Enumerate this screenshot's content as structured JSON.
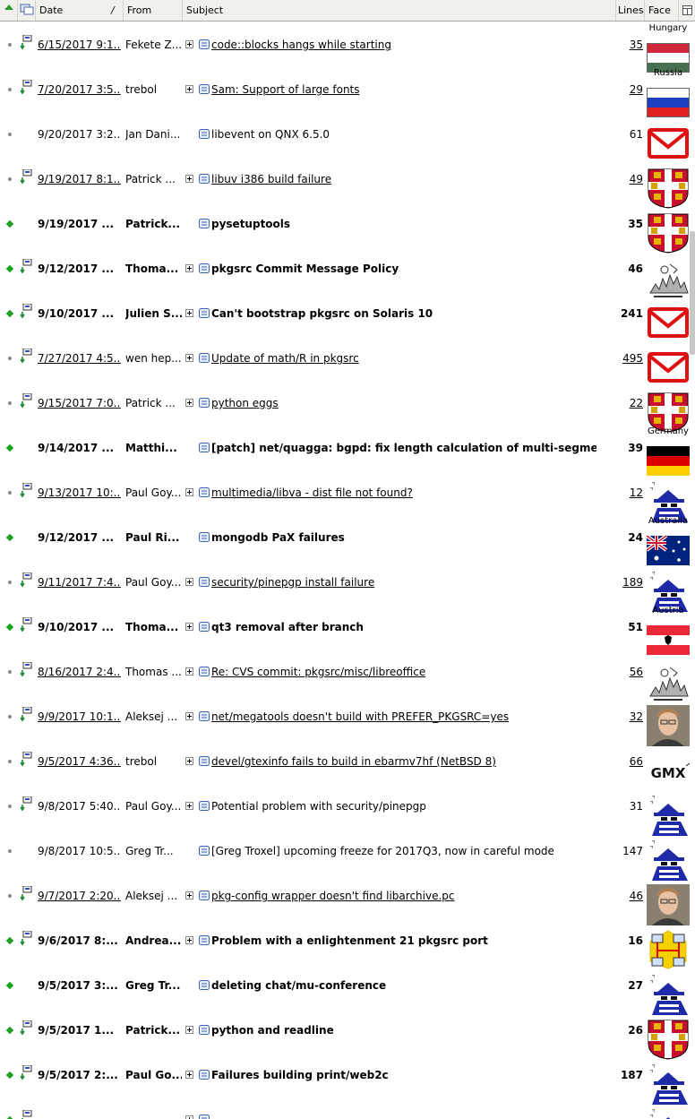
{
  "header": {
    "date_label": "Date",
    "sort_indicator": "/",
    "from_label": "From",
    "subject_label": "Subject",
    "lines_label": "Lines",
    "face_label": "Face"
  },
  "messages": [
    {
      "date": "6/15/2017 9:1...",
      "from": "Fekete Z...",
      "subject": "code::blocks hangs while starting",
      "lines": "35",
      "unread": false,
      "underline": true,
      "attach": true,
      "expand": true,
      "face": "flag-hungary",
      "flag_label": "Hungary"
    },
    {
      "date": "7/20/2017 3:5...",
      "from": "trebol",
      "subject": "Sam: Support of large fonts",
      "lines": "29",
      "unread": false,
      "underline": true,
      "attach": true,
      "expand": true,
      "face": "flag-russia",
      "flag_label": "Russia"
    },
    {
      "date": "9/20/2017 3:2...",
      "from": "Jan Dani...",
      "subject": "libevent on QNX 6.5.0",
      "lines": "61",
      "unread": false,
      "underline": false,
      "attach": false,
      "expand": false,
      "face": "mail",
      "flag_label": ""
    },
    {
      "date": "9/19/2017 8:1...",
      "from": "Patrick ...",
      "subject": "libuv i386 build failure",
      "lines": "49",
      "unread": false,
      "underline": true,
      "attach": true,
      "expand": true,
      "face": "crest",
      "flag_label": ""
    },
    {
      "date": "9/19/2017 ...",
      "from": "Patrick...",
      "subject": "pysetuptools",
      "lines": "35",
      "unread": true,
      "underline": false,
      "attach": false,
      "expand": false,
      "face": "crest",
      "flag_label": ""
    },
    {
      "date": "9/12/2017 ...",
      "from": "Thoma...",
      "subject": "pkgsrc Commit Message Policy",
      "lines": "46",
      "unread": true,
      "underline": false,
      "attach": true,
      "expand": true,
      "face": "sketch",
      "flag_label": ""
    },
    {
      "date": "9/10/2017 ...",
      "from": "Julien S...",
      "subject": "Can't bootstrap pkgsrc on Solaris 10",
      "lines": "241",
      "unread": true,
      "underline": false,
      "attach": true,
      "expand": true,
      "face": "mail",
      "flag_label": ""
    },
    {
      "date": "7/27/2017 4:5...",
      "from": "wen hep...",
      "subject": "Update of math/R in pkgsrc",
      "lines": "495",
      "unread": false,
      "underline": true,
      "attach": true,
      "expand": true,
      "face": "mail",
      "flag_label": ""
    },
    {
      "date": "9/15/2017 7:0...",
      "from": "Patrick ...",
      "subject": "python eggs",
      "lines": "22",
      "unread": false,
      "underline": true,
      "attach": true,
      "expand": true,
      "face": "crest",
      "flag_label": ""
    },
    {
      "date": "9/14/2017 ...",
      "from": "Matthi...",
      "subject": "[patch] net/quagga: bgpd: fix length calculation of multi-segme...",
      "lines": "39",
      "unread": true,
      "underline": false,
      "attach": false,
      "expand": false,
      "face": "flag-germany",
      "flag_label": "Germany"
    },
    {
      "date": "9/13/2017 10:...",
      "from": "Paul Goy...",
      "subject": "multimedia/libva - dist file not found?",
      "lines": "12",
      "unread": false,
      "underline": true,
      "attach": true,
      "expand": true,
      "face": "spy",
      "flag_label": ""
    },
    {
      "date": "9/12/2017 ...",
      "from": "Paul Ri...",
      "subject": "mongodb PaX failures",
      "lines": "24",
      "unread": true,
      "underline": false,
      "attach": false,
      "expand": false,
      "face": "flag-australia",
      "flag_label": "Australia"
    },
    {
      "date": "9/11/2017 7:4...",
      "from": "Paul Goy...",
      "subject": "security/pinepgp install failure",
      "lines": "189",
      "unread": false,
      "underline": true,
      "attach": true,
      "expand": true,
      "face": "spy",
      "flag_label": ""
    },
    {
      "date": "9/10/2017 ...",
      "from": "Thoma...",
      "subject": "qt3 removal after branch",
      "lines": "51",
      "unread": true,
      "underline": false,
      "attach": true,
      "expand": true,
      "face": "flag-austria",
      "flag_label": "Austria"
    },
    {
      "date": "8/16/2017 2:4...",
      "from": "Thomas ...",
      "subject": "Re: CVS commit: pkgsrc/misc/libreoffice",
      "lines": "56",
      "unread": false,
      "underline": true,
      "attach": true,
      "expand": true,
      "face": "sketch",
      "flag_label": ""
    },
    {
      "date": "9/9/2017 10:1...",
      "from": "Aleksej ...",
      "subject": "net/megatools doesn't build with PREFER_PKGSRC=yes",
      "lines": "32",
      "unread": false,
      "underline": true,
      "attach": true,
      "expand": true,
      "face": "person",
      "flag_label": ""
    },
    {
      "date": "9/5/2017 4:36...",
      "from": "trebol",
      "subject": "devel/gtexinfo fails to build in ebarmv7hf (NetBSD 8)",
      "lines": "66",
      "unread": false,
      "underline": true,
      "attach": true,
      "expand": true,
      "face": "gmx",
      "flag_label": ""
    },
    {
      "date": "9/8/2017 5:40...",
      "from": "Paul Goy...",
      "subject": "Potential problem with security/pinepgp",
      "lines": "31",
      "unread": false,
      "underline": false,
      "attach": true,
      "expand": true,
      "face": "spy",
      "flag_label": ""
    },
    {
      "date": "9/8/2017 10:5...",
      "from": "Greg Tr...",
      "subject": "[Greg Troxel] upcoming freeze for 2017Q3, now in careful mode",
      "lines": "147",
      "unread": false,
      "underline": false,
      "attach": false,
      "expand": false,
      "face": "spy",
      "flag_label": ""
    },
    {
      "date": "9/7/2017 2:20...",
      "from": "Aleksej ...",
      "subject": "pkg-config wrapper doesn't find libarchive.pc",
      "lines": "46",
      "unread": false,
      "underline": true,
      "attach": true,
      "expand": true,
      "face": "person",
      "flag_label": ""
    },
    {
      "date": "9/6/2017 8:...",
      "from": "Andrea...",
      "subject": "Problem with a enlightenment 21 pkgsrc port",
      "lines": "16",
      "unread": true,
      "underline": false,
      "attach": true,
      "expand": true,
      "face": "network",
      "flag_label": ""
    },
    {
      "date": "9/5/2017 3:...",
      "from": "Greg Tr...",
      "subject": "deleting chat/mu-conference",
      "lines": "27",
      "unread": true,
      "underline": false,
      "attach": false,
      "expand": false,
      "face": "spy",
      "flag_label": ""
    },
    {
      "date": "9/5/2017 1...",
      "from": "Patrick...",
      "subject": "python and readline",
      "lines": "26",
      "unread": true,
      "underline": false,
      "attach": true,
      "expand": true,
      "face": "crest",
      "flag_label": ""
    },
    {
      "date": "9/5/2017 2:...",
      "from": "Paul Go...",
      "subject": "Failures building print/web2c",
      "lines": "187",
      "unread": true,
      "underline": false,
      "attach": true,
      "expand": true,
      "face": "spy",
      "flag_label": ""
    },
    {
      "date": "",
      "from": "",
      "subject": "",
      "lines": "",
      "unread": true,
      "underline": false,
      "attach": true,
      "expand": true,
      "face": "spy",
      "flag_label": ""
    }
  ],
  "colors": {
    "unread_bullet": "#1ea21e",
    "read_bullet": "#8a8a8a",
    "mail_red": "#e01010"
  }
}
